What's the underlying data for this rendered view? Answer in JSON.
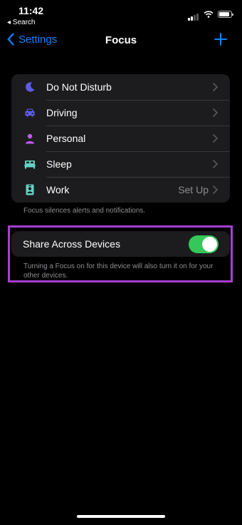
{
  "status_bar": {
    "time": "11:42",
    "back_app": "◂ Search"
  },
  "nav": {
    "back_label": "Settings",
    "title": "Focus"
  },
  "focus_modes": [
    {
      "label": "Do Not Disturb",
      "icon": "moon-icon",
      "color": "#5e5ce6",
      "detail": ""
    },
    {
      "label": "Driving",
      "icon": "car-icon",
      "color": "#5e5ce6",
      "detail": ""
    },
    {
      "label": "Personal",
      "icon": "person-icon",
      "color": "#bf5af2",
      "detail": ""
    },
    {
      "label": "Sleep",
      "icon": "bed-icon",
      "color": "#64d2c2",
      "detail": ""
    },
    {
      "label": "Work",
      "icon": "id-badge-icon",
      "color": "#64d2c2",
      "detail": "Set Up"
    }
  ],
  "focus_note": "Focus silences alerts and notifications.",
  "share": {
    "label": "Share Across Devices",
    "enabled": true,
    "description": "Turning a Focus on for this device will also turn it on for your other devices."
  },
  "colors": {
    "accent": "#0a84ff",
    "toggle_on": "#34c759",
    "highlight": "#a43fd0"
  }
}
